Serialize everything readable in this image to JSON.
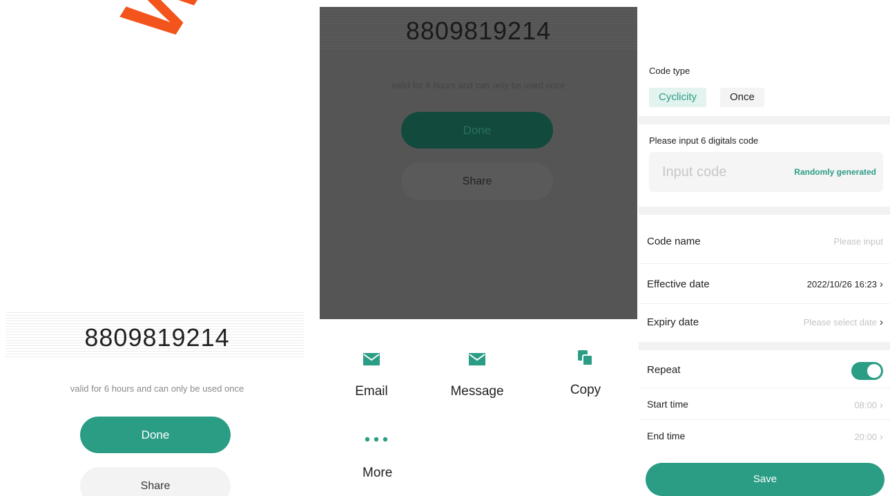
{
  "panel1": {
    "watermark": "WWW",
    "code": "8809819214",
    "note": "valid for 6 hours and can only be used once",
    "done_label": "Done",
    "share_label": "Share"
  },
  "panel2": {
    "code": "8809819214",
    "note": "valid for 6 hours and can only be used once",
    "done_label": "Done",
    "share_label": "Share",
    "share_options": [
      {
        "label": "Email",
        "icon": "envelope-icon"
      },
      {
        "label": "Message",
        "icon": "envelope-icon"
      },
      {
        "label": "Copy",
        "icon": "copy-icon"
      },
      {
        "label": "More",
        "icon": "more-dots-icon"
      }
    ]
  },
  "panel3": {
    "code_type_label": "Code type",
    "code_type_options": [
      "Cyclicity",
      "Once"
    ],
    "code_type_selected": "Cyclicity",
    "input_label": "Please input 6 digitals code",
    "input_placeholder": "Input code",
    "random_label": "Randomly generated",
    "code_name_label": "Code name",
    "code_name_placeholder": "Please input",
    "effective_label": "Effective date",
    "effective_value": "2022/10/26 16:23",
    "expiry_label": "Expiry date",
    "expiry_placeholder": "Please select date",
    "repeat_label": "Repeat",
    "repeat_on": true,
    "start_label": "Start time",
    "start_value": "08:00",
    "end_label": "End time",
    "end_value": "20:00",
    "save_label": "Save"
  },
  "colors": {
    "accent": "#2a9d84",
    "watermark": "#f2541b",
    "overlay": "#555555"
  }
}
